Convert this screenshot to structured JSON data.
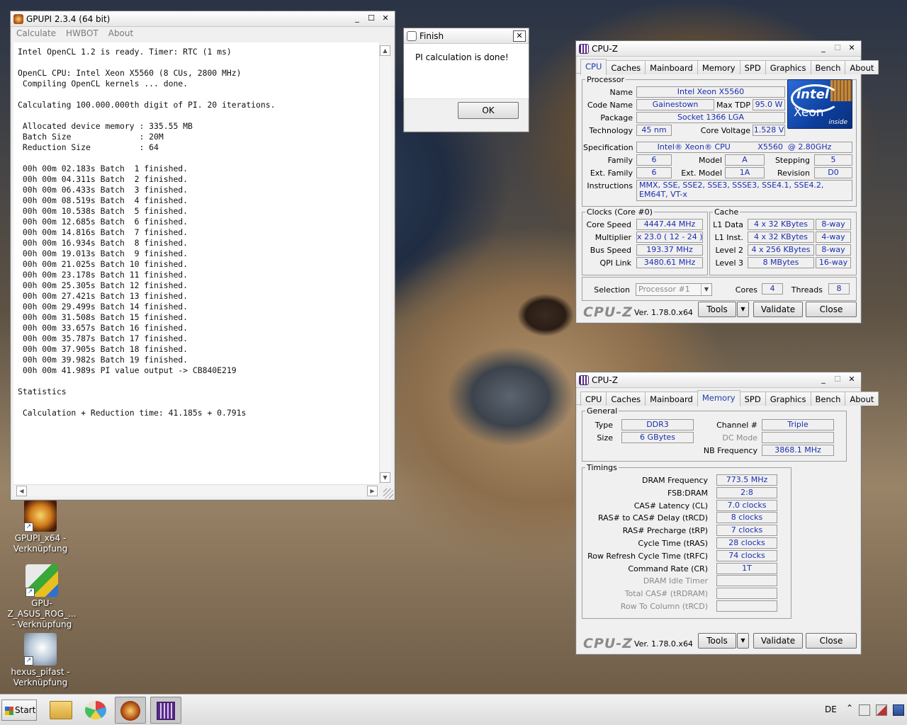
{
  "desktop": {
    "icons": [
      {
        "line1": "GPUPI_x64 -",
        "line2": "Verknüpfung"
      },
      {
        "line1": "GPU-Z_ASUS_ROG_...",
        "line2": "- Verknüpfung"
      },
      {
        "line1": "hexus_pifast -",
        "line2": "Verknüpfung"
      }
    ]
  },
  "gpupi": {
    "title": "GPUPI 2.3.4 (64 bit)",
    "menu": [
      "Calculate",
      "HWBOT",
      "About"
    ],
    "log": [
      "Intel OpenCL 1.2 is ready. Timer: RTC (1 ms)",
      "",
      "OpenCL CPU: Intel Xeon X5560 (8 CUs, 2800 MHz)",
      " Compiling OpenCL kernels ... done.",
      "",
      "Calculating 100.000.000th digit of PI. 20 iterations.",
      "",
      " Allocated device memory : 335.55 MB",
      " Batch Size              : 20M",
      " Reduction Size          : 64",
      "",
      " 00h 00m 02.183s Batch  1 finished.",
      " 00h 00m 04.311s Batch  2 finished.",
      " 00h 00m 06.433s Batch  3 finished.",
      " 00h 00m 08.519s Batch  4 finished.",
      " 00h 00m 10.538s Batch  5 finished.",
      " 00h 00m 12.685s Batch  6 finished.",
      " 00h 00m 14.816s Batch  7 finished.",
      " 00h 00m 16.934s Batch  8 finished.",
      " 00h 00m 19.013s Batch  9 finished.",
      " 00h 00m 21.025s Batch 10 finished.",
      " 00h 00m 23.178s Batch 11 finished.",
      " 00h 00m 25.305s Batch 12 finished.",
      " 00h 00m 27.421s Batch 13 finished.",
      " 00h 00m 29.499s Batch 14 finished.",
      " 00h 00m 31.508s Batch 15 finished.",
      " 00h 00m 33.657s Batch 16 finished.",
      " 00h 00m 35.787s Batch 17 finished.",
      " 00h 00m 37.905s Batch 18 finished.",
      " 00h 00m 39.982s Batch 19 finished.",
      " 00h 00m 41.989s PI value output -> CB840E219",
      "",
      "Statistics",
      "",
      " Calculation + Reduction time: 41.185s + 0.791s"
    ]
  },
  "finish": {
    "title": "Finish",
    "message": "PI calculation is done!",
    "ok": "OK"
  },
  "cpuz_common": {
    "title": "CPU-Z",
    "tabs": [
      "CPU",
      "Caches",
      "Mainboard",
      "Memory",
      "SPD",
      "Graphics",
      "Bench",
      "About"
    ],
    "brand": "CPU-Z",
    "version": "Ver. 1.78.0.x64",
    "tools": "Tools",
    "validate": "Validate",
    "close": "Close"
  },
  "cpu": {
    "processor_legend": "Processor",
    "name_label": "Name",
    "name": "Intel Xeon X5560",
    "codename_label": "Code Name",
    "codename": "Gainestown",
    "maxtdp_label": "Max TDP",
    "maxtdp": "95.0 W",
    "package_label": "Package",
    "package": "Socket 1366 LGA",
    "technology_label": "Technology",
    "technology": "45 nm",
    "corevoltage_label": "Core Voltage",
    "corevoltage": "1.528 V",
    "spec_label": "Specification",
    "spec": "Intel® Xeon® CPU           X5560  @ 2.80GHz",
    "family_label": "Family",
    "family": "6",
    "model_label": "Model",
    "model": "A",
    "stepping_label": "Stepping",
    "stepping": "5",
    "extfamily_label": "Ext. Family",
    "extfamily": "6",
    "extmodel_label": "Ext. Model",
    "extmodel": "1A",
    "revision_label": "Revision",
    "revision": "D0",
    "instructions_label": "Instructions",
    "instructions": "MMX, SSE, SSE2, SSE3, SSSE3, SSE4.1, SSE4.2, EM64T, VT-x",
    "logo": {
      "brand": "intel",
      "product": "Xeon",
      "tag": "inside"
    },
    "clocks_legend": "Clocks (Core #0)",
    "corespeed_label": "Core Speed",
    "corespeed": "4447.44 MHz",
    "multiplier_label": "Multiplier",
    "multiplier": "x 23.0 ( 12 - 24 )",
    "busspeed_label": "Bus Speed",
    "busspeed": "193.37 MHz",
    "qpilink_label": "QPI Link",
    "qpilink": "3480.61 MHz",
    "cache_legend": "Cache",
    "l1d_label": "L1 Data",
    "l1d": "4 x 32 KBytes",
    "l1d_way": "8-way",
    "l1i_label": "L1 Inst.",
    "l1i": "4 x 32 KBytes",
    "l1i_way": "4-way",
    "l2_label": "Level 2",
    "l2": "4 x 256 KBytes",
    "l2_way": "8-way",
    "l3_label": "Level 3",
    "l3": "8 MBytes",
    "l3_way": "16-way",
    "selection_label": "Selection",
    "selection": "Processor #1",
    "cores_label": "Cores",
    "cores": "4",
    "threads_label": "Threads",
    "threads": "8"
  },
  "memory": {
    "general_legend": "General",
    "type_label": "Type",
    "type": "DDR3",
    "size_label": "Size",
    "size": "6 GBytes",
    "channel_label": "Channel #",
    "channel": "Triple",
    "dcmode_label": "DC Mode",
    "dcmode": "",
    "nbfreq_label": "NB Frequency",
    "nbfreq": "3868.1 MHz",
    "timings_legend": "Timings",
    "timings": [
      {
        "label": "DRAM Frequency",
        "value": "773.5 MHz"
      },
      {
        "label": "FSB:DRAM",
        "value": "2:8"
      },
      {
        "label": "CAS# Latency (CL)",
        "value": "7.0 clocks"
      },
      {
        "label": "RAS# to CAS# Delay (tRCD)",
        "value": "8 clocks"
      },
      {
        "label": "RAS# Precharge (tRP)",
        "value": "7 clocks"
      },
      {
        "label": "Cycle Time (tRAS)",
        "value": "28 clocks"
      },
      {
        "label": "Row Refresh Cycle Time (tRFC)",
        "value": "74 clocks"
      },
      {
        "label": "Command Rate (CR)",
        "value": "1T"
      },
      {
        "label": "DRAM Idle Timer",
        "value": ""
      },
      {
        "label": "Total CAS# (tRDRAM)",
        "value": ""
      },
      {
        "label": "Row To Column (tRCD)",
        "value": ""
      }
    ]
  },
  "taskbar": {
    "start": "Start",
    "language": "DE"
  }
}
